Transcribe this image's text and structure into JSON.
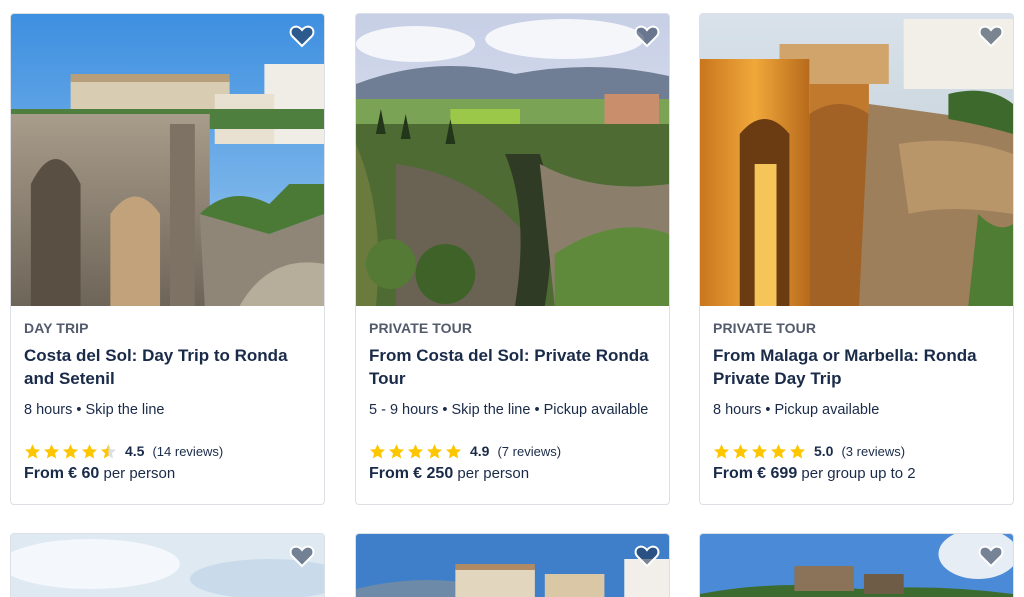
{
  "colors": {
    "star": "#fdc600",
    "text": "#1a2b49",
    "category": "#525a6b",
    "border": "#dcdfe4"
  },
  "cards": [
    {
      "category": "DAY TRIP",
      "title": "Costa del Sol: Day Trip to Ronda and Setenil",
      "meta": "8 hours • Skip the line",
      "rating": "4.5",
      "stars": 4.5,
      "reviews": "(14 reviews)",
      "price_prefix": "From",
      "price_amount": "€ 60",
      "price_suffix": "per person",
      "heart_icon": "heart-outline-icon"
    },
    {
      "category": "PRIVATE TOUR",
      "title": "From Costa del Sol: Private Ronda Tour",
      "meta": "5 - 9 hours • Skip the line • Pickup available",
      "rating": "4.9",
      "stars": 5,
      "reviews": "(7 reviews)",
      "price_prefix": "From",
      "price_amount": "€ 250",
      "price_suffix": "per person",
      "heart_icon": "heart-outline-icon"
    },
    {
      "category": "PRIVATE TOUR",
      "title": "From Malaga or Marbella: Ronda Private Day Trip",
      "meta": "8 hours • Pickup available",
      "rating": "5.0",
      "stars": 5,
      "reviews": "(3 reviews)",
      "price_prefix": "From",
      "price_amount": "€ 699",
      "price_suffix": "per group up to 2",
      "heart_icon": "heart-outline-icon"
    }
  ]
}
